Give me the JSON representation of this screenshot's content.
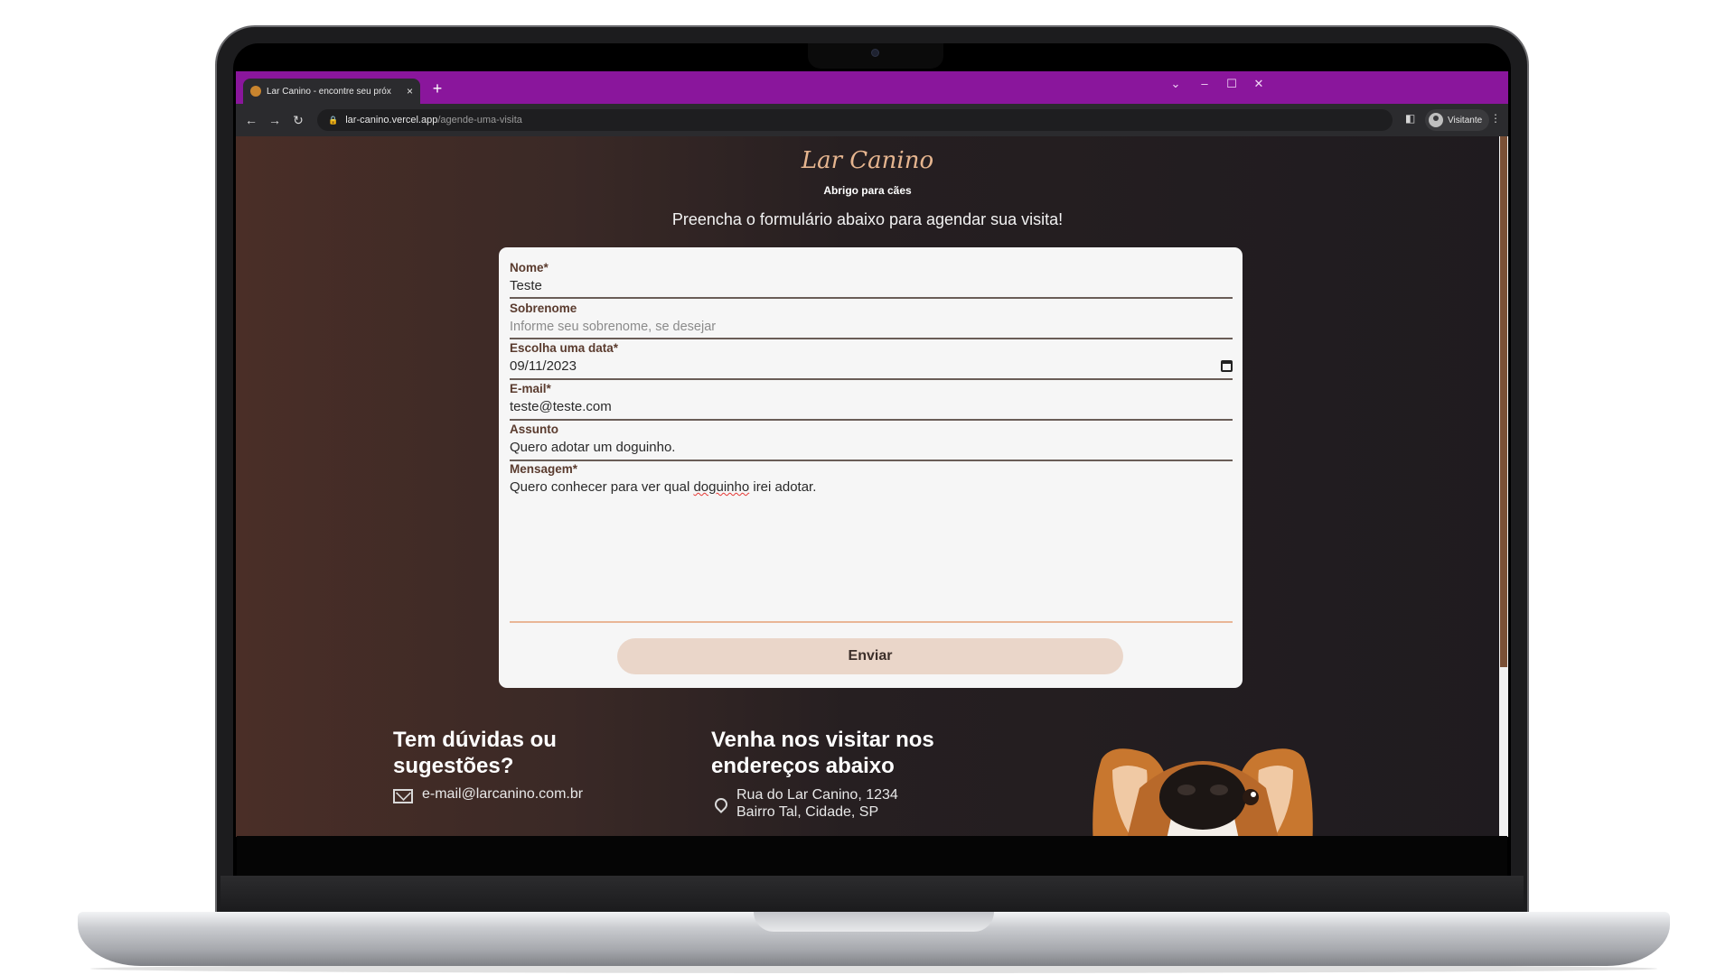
{
  "browser": {
    "tab_title": "Lar Canino - encontre seu próximo",
    "tab_close": "×",
    "new_tab": "+",
    "url_host": "lar-canino.vercel.app",
    "url_path": "/agende-uma-visita",
    "profile_name": "Visitante",
    "window_controls": {
      "dropdown": "⌄",
      "minimize": "–",
      "maximize": "☐",
      "close": "✕"
    },
    "accent_color": "#8a169c"
  },
  "header": {
    "logo": "Lar Canino",
    "subtitle": "Abrigo para cães",
    "lead": "Preencha o formulário abaixo para agendar sua visita!"
  },
  "form": {
    "nome": {
      "label": "Nome*",
      "value": "Teste"
    },
    "sobrenome": {
      "label": "Sobrenome",
      "placeholder": "Informe seu sobrenome, se desejar"
    },
    "data": {
      "label": "Escolha uma data*",
      "value": "09/11/2023"
    },
    "email": {
      "label": "E-mail*",
      "value": "teste@teste.com"
    },
    "assunto": {
      "label": "Assunto",
      "value": "Quero adotar um doguinho."
    },
    "mensagem": {
      "label": "Mensagem*",
      "before": "Quero conhecer para ver qual ",
      "misspelled": "doguinho",
      "after": " irei adotar."
    },
    "submit_label": "Enviar"
  },
  "footer": {
    "contact_heading_1": "Tem dúvidas ou",
    "contact_heading_2": "sugestões?",
    "contact_email": "e-mail@larcanino.com.br",
    "visit_heading_1": "Venha nos visitar nos",
    "visit_heading_2": "endereços abaixo",
    "address_line_1": "Rua do Lar Canino, 1234",
    "address_line_2": "Bairro Tal, Cidade, SP"
  },
  "icons": [
    "back-icon",
    "forward-icon",
    "reload-icon",
    "lock-icon",
    "sidepanel-icon",
    "avatar-icon",
    "menu-icon",
    "calendar-icon",
    "mail-icon",
    "pin-icon"
  ]
}
